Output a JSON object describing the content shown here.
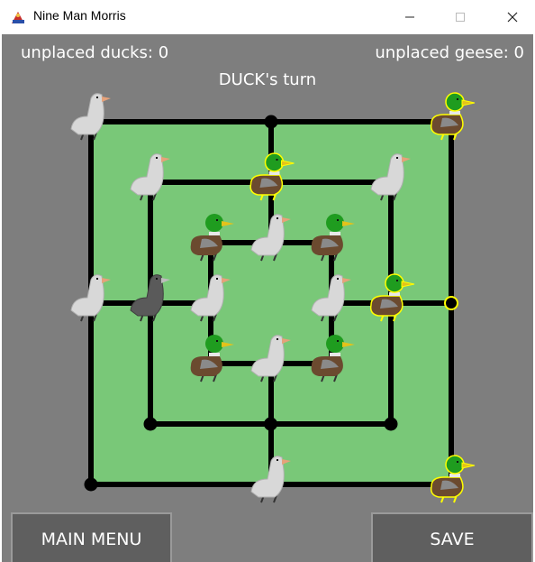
{
  "window": {
    "title": "Nine Man Morris",
    "minimize_glyph": "—",
    "maximize_glyph": "☐",
    "close_glyph": "✕"
  },
  "status": {
    "unplaced_ducks": "unplaced ducks: 0",
    "unplaced_geese": "unplaced geese: 0",
    "turn": "DUCK's turn"
  },
  "buttons": {
    "main_menu": "MAIN MENU",
    "save": "SAVE"
  },
  "colors": {
    "game_bg": "#7e7e7e",
    "board": "#79c878",
    "line": "#000000",
    "highlight": "#ffff00",
    "button_bg": "#5f5f5f"
  },
  "board": {
    "pieces": [
      {
        "ring": "outer",
        "pos": "top-left",
        "piece": "goose"
      },
      {
        "ring": "outer",
        "pos": "top-middle",
        "piece": "empty"
      },
      {
        "ring": "outer",
        "pos": "top-right",
        "piece": "duck",
        "selected": true
      },
      {
        "ring": "outer",
        "pos": "middle-left",
        "piece": "goose"
      },
      {
        "ring": "outer",
        "pos": "middle-right",
        "piece": "empty",
        "selected": true
      },
      {
        "ring": "outer",
        "pos": "bottom-left",
        "piece": "empty"
      },
      {
        "ring": "outer",
        "pos": "bottom-middle",
        "piece": "goose"
      },
      {
        "ring": "outer",
        "pos": "bottom-right",
        "piece": "duck",
        "selected": true
      },
      {
        "ring": "middle",
        "pos": "top-left",
        "piece": "goose"
      },
      {
        "ring": "middle",
        "pos": "top-middle",
        "piece": "duck",
        "selected": true
      },
      {
        "ring": "middle",
        "pos": "top-right",
        "piece": "goose"
      },
      {
        "ring": "middle",
        "pos": "middle-left",
        "piece": "dark-goose"
      },
      {
        "ring": "middle",
        "pos": "middle-right",
        "piece": "duck",
        "selected": true
      },
      {
        "ring": "middle",
        "pos": "bottom-left",
        "piece": "empty"
      },
      {
        "ring": "middle",
        "pos": "bottom-middle",
        "piece": "empty"
      },
      {
        "ring": "middle",
        "pos": "bottom-right",
        "piece": "empty"
      },
      {
        "ring": "inner",
        "pos": "top-left",
        "piece": "duck"
      },
      {
        "ring": "inner",
        "pos": "top-middle",
        "piece": "goose"
      },
      {
        "ring": "inner",
        "pos": "top-right",
        "piece": "duck"
      },
      {
        "ring": "inner",
        "pos": "middle-left",
        "piece": "goose"
      },
      {
        "ring": "inner",
        "pos": "middle-right",
        "piece": "goose"
      },
      {
        "ring": "inner",
        "pos": "bottom-left",
        "piece": "duck"
      },
      {
        "ring": "inner",
        "pos": "bottom-middle",
        "piece": "goose"
      },
      {
        "ring": "inner",
        "pos": "bottom-right",
        "piece": "duck"
      }
    ]
  }
}
